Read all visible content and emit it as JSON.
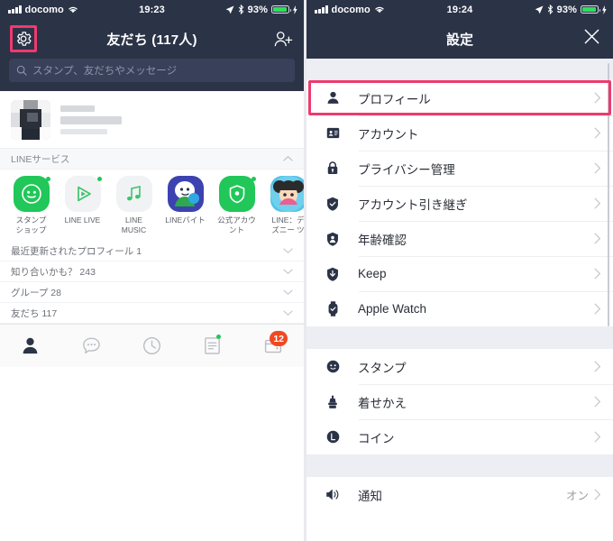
{
  "left": {
    "status": {
      "carrier": "docomo",
      "time": "19:23",
      "battery": "93%"
    },
    "nav": {
      "title": "友だち (117人)",
      "settings_icon": "gear-icon",
      "add_friend_icon": "add-friend-icon"
    },
    "search": {
      "placeholder": "スタンプ、友だちやメッセージ"
    },
    "services": {
      "header": "LINEサービス",
      "items": [
        {
          "label": "スタンプ\nショップ",
          "badge": true
        },
        {
          "label": "LINE LIVE",
          "badge": true
        },
        {
          "label": "LINE\nMUSIC",
          "badge": false
        },
        {
          "label": "LINEバイト",
          "badge": false
        },
        {
          "label": "公式アカウント",
          "badge": true
        },
        {
          "label": "LINE：ディズニー ツ",
          "badge": false
        }
      ]
    },
    "lists": [
      {
        "label": "最近更新されたプロフィール 1"
      },
      {
        "label": "知り合いかも？ 243"
      },
      {
        "label": "グループ 28"
      },
      {
        "label": "友だち 117"
      }
    ],
    "tabs": [
      {
        "name": "friends",
        "icon": "person-icon",
        "active": true,
        "badge": ""
      },
      {
        "name": "chats",
        "icon": "chat-icon",
        "active": false,
        "badge": ""
      },
      {
        "name": "timeline",
        "icon": "clock-icon",
        "active": false,
        "badge": ""
      },
      {
        "name": "news",
        "icon": "news-icon",
        "active": false,
        "badge": "",
        "dot": true
      },
      {
        "name": "wallet",
        "icon": "wallet-icon",
        "active": false,
        "badge": "12"
      }
    ]
  },
  "right": {
    "status": {
      "carrier": "docomo",
      "time": "19:24",
      "battery": "93%"
    },
    "nav": {
      "title": "設定",
      "close_icon": "close-icon"
    },
    "groups": [
      {
        "items": [
          {
            "label": "プロフィール",
            "icon": "person-icon",
            "value": "",
            "highlight": true
          },
          {
            "label": "アカウント",
            "icon": "id-card-icon",
            "value": ""
          },
          {
            "label": "プライバシー管理",
            "icon": "lock-icon",
            "value": ""
          },
          {
            "label": "アカウント引き継ぎ",
            "icon": "shield-check-icon",
            "value": ""
          },
          {
            "label": "年齢確認",
            "icon": "shield-person-icon",
            "value": ""
          },
          {
            "label": "Keep",
            "icon": "download-icon",
            "value": ""
          },
          {
            "label": "Apple Watch",
            "icon": "watch-icon",
            "value": ""
          }
        ]
      },
      {
        "items": [
          {
            "label": "スタンプ",
            "icon": "smiley-icon",
            "value": ""
          },
          {
            "label": "着せかえ",
            "icon": "brush-icon",
            "value": ""
          },
          {
            "label": "コイン",
            "icon": "coin-icon",
            "value": ""
          }
        ]
      },
      {
        "items": [
          {
            "label": "通知",
            "icon": "speaker-icon",
            "value": "オン"
          }
        ]
      }
    ]
  },
  "colors": {
    "navy": "#2b3347",
    "highlight_pink": "#ee3a6e",
    "line_green": "#21c759",
    "badge_red": "#f04922"
  }
}
